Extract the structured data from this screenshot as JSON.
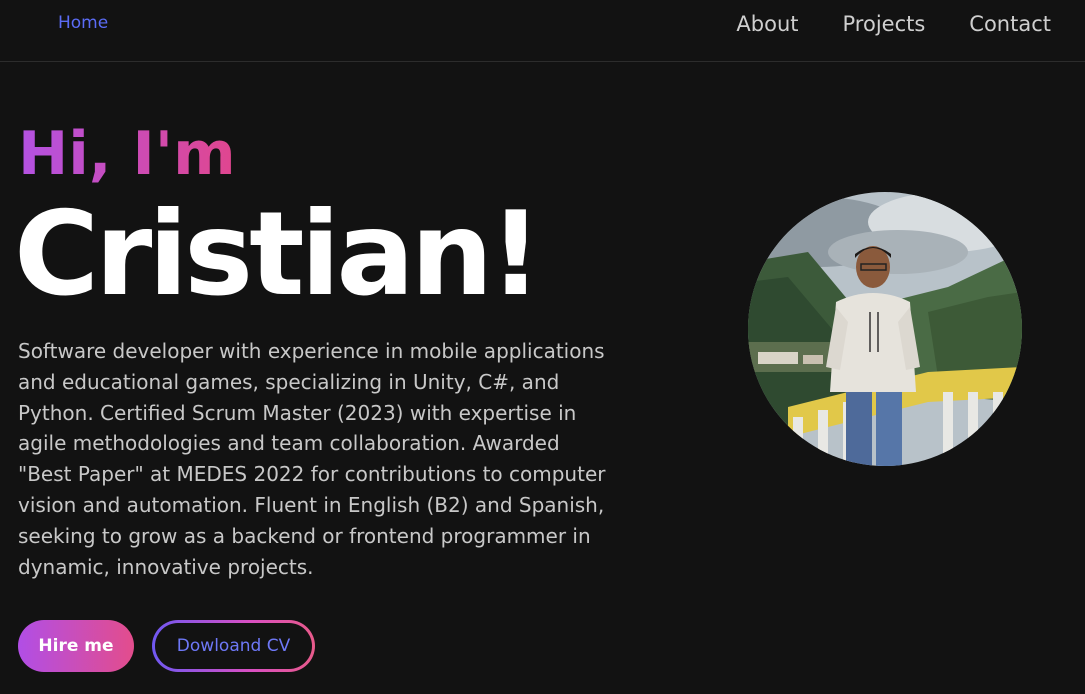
{
  "nav": {
    "home": "Home",
    "links": [
      "About",
      "Projects",
      "Contact"
    ]
  },
  "hero": {
    "greeting": "Hi, I'm",
    "name": "Cristian!",
    "description": "Software developer with experience in mobile applications and educational games, specializing in Unity, C#, and Python. Certified Scrum Master (2023) with expertise in agile methodologies and team collaboration. Awarded \"Best Paper\" at MEDES 2022 for contributions to computer vision and automation. Fluent in English (B2) and Spanish, seeking to grow as a backend or frontend programmer in dynamic, innovative projects.",
    "hire_label": "Hire me",
    "cv_label": "Dowloand CV"
  },
  "colors": {
    "background": "#121212",
    "accent_purple": "#b352e3",
    "accent_pink": "#e1468e",
    "link_blue": "#5b6cf6"
  },
  "avatar": {
    "icon": "profile-photo"
  }
}
